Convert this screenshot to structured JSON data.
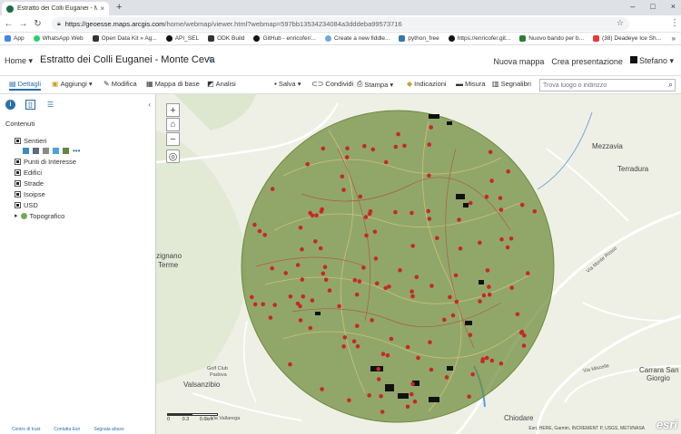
{
  "browser": {
    "tab_title": "Estratto dei Colli Euganei - Monte",
    "tab_close": "×",
    "new_tab": "+",
    "url_host": "https://geoesse.maps.arcgis.com",
    "url_path": "/home/webmap/viewer.html?webmap=597bb13534234084a3dddeba99573716",
    "window_controls": [
      "–",
      "□",
      "×"
    ],
    "bookmarks": [
      {
        "label": "App",
        "color": "#4285f4"
      },
      {
        "label": "WhatsApp Web",
        "color": "#25d366"
      },
      {
        "label": "Open Data Kit » Ag...",
        "color": "#333333"
      },
      {
        "label": "API_SEL",
        "color": "#111111"
      },
      {
        "label": "ODK Build",
        "color": "#333333"
      },
      {
        "label": "GitHub - enricofer/...",
        "color": "#111111"
      },
      {
        "label": "Create a new fiddle...",
        "color": "#6fa8dc"
      },
      {
        "label": "python_free",
        "color": "#3776ab"
      },
      {
        "label": "https://enricofer.git...",
        "color": "#111111"
      },
      {
        "label": "Nuovo bando per b...",
        "color": "#2e7d32"
      },
      {
        "label": "(38) Deadeye Ice Sh...",
        "color": "#e53935"
      }
    ],
    "bookmarks_more": "»"
  },
  "header": {
    "home_label": "Home ▾",
    "map_title": "Estratto dei Colli Euganei - Monte Ceva",
    "new_map": "Nuova mappa",
    "create_presentation": "Crea presentazione",
    "user": "Stefano ▾"
  },
  "toolbar": {
    "details": "Dettagli",
    "add": "Aggiungi ▾",
    "modify": "Modifica",
    "basemap": "Mappa di base",
    "analysis": "Analisi",
    "save": "Salva ▾",
    "share": "Condividi",
    "print": "Stampa ▾",
    "directions": "Indicazioni",
    "measure": "Misura",
    "bookmarks": "Segnalibri",
    "search_placeholder": "Trova luogo o indirizzo"
  },
  "panel": {
    "contents_title": "Contenuti",
    "layers": [
      {
        "label": "Sentieri",
        "checked": true
      },
      {
        "label": "Punti di Interesse",
        "checked": true
      },
      {
        "label": "Edifici",
        "checked": true
      },
      {
        "label": "Strade",
        "checked": true
      },
      {
        "label": "Isoipse",
        "checked": true
      },
      {
        "label": "USD",
        "checked": true
      },
      {
        "label": "Topografico",
        "checked": false
      }
    ],
    "footer_links": [
      "Centro di trust",
      "Contatta Esri",
      "Segnala abuso"
    ]
  },
  "map": {
    "labels": {
      "mezzavia": "Mezzavia",
      "terradura": "Terradura",
      "galzignano_1": "zignano",
      "galzignano_2": "Terme",
      "valsanzibio": "Valsanzibio",
      "chiodare": "Chiodare",
      "carrara_1": "Carrara San",
      "carrara_2": "Giorgio",
      "golf": "Golf Club",
      "golf2": "Padova",
      "via_vallarega": "Via Vallarega",
      "via_monte_rosso": "Via Monte Rosso",
      "via_miscelle": "Via Miscelle"
    },
    "scale_labels": [
      "0",
      "0.3",
      "0.6km"
    ],
    "attribution": "Esri, HERE, Garmin, INCREMENT P, USGS, METI/NASA",
    "logo": "esri",
    "controls": [
      "+",
      "⌂",
      "−",
      "◎"
    ]
  },
  "colors": {
    "accent": "#2a6fa8",
    "buffer_fill": "#6e8a3a",
    "point_red": "#c62828",
    "building": "#111111"
  }
}
